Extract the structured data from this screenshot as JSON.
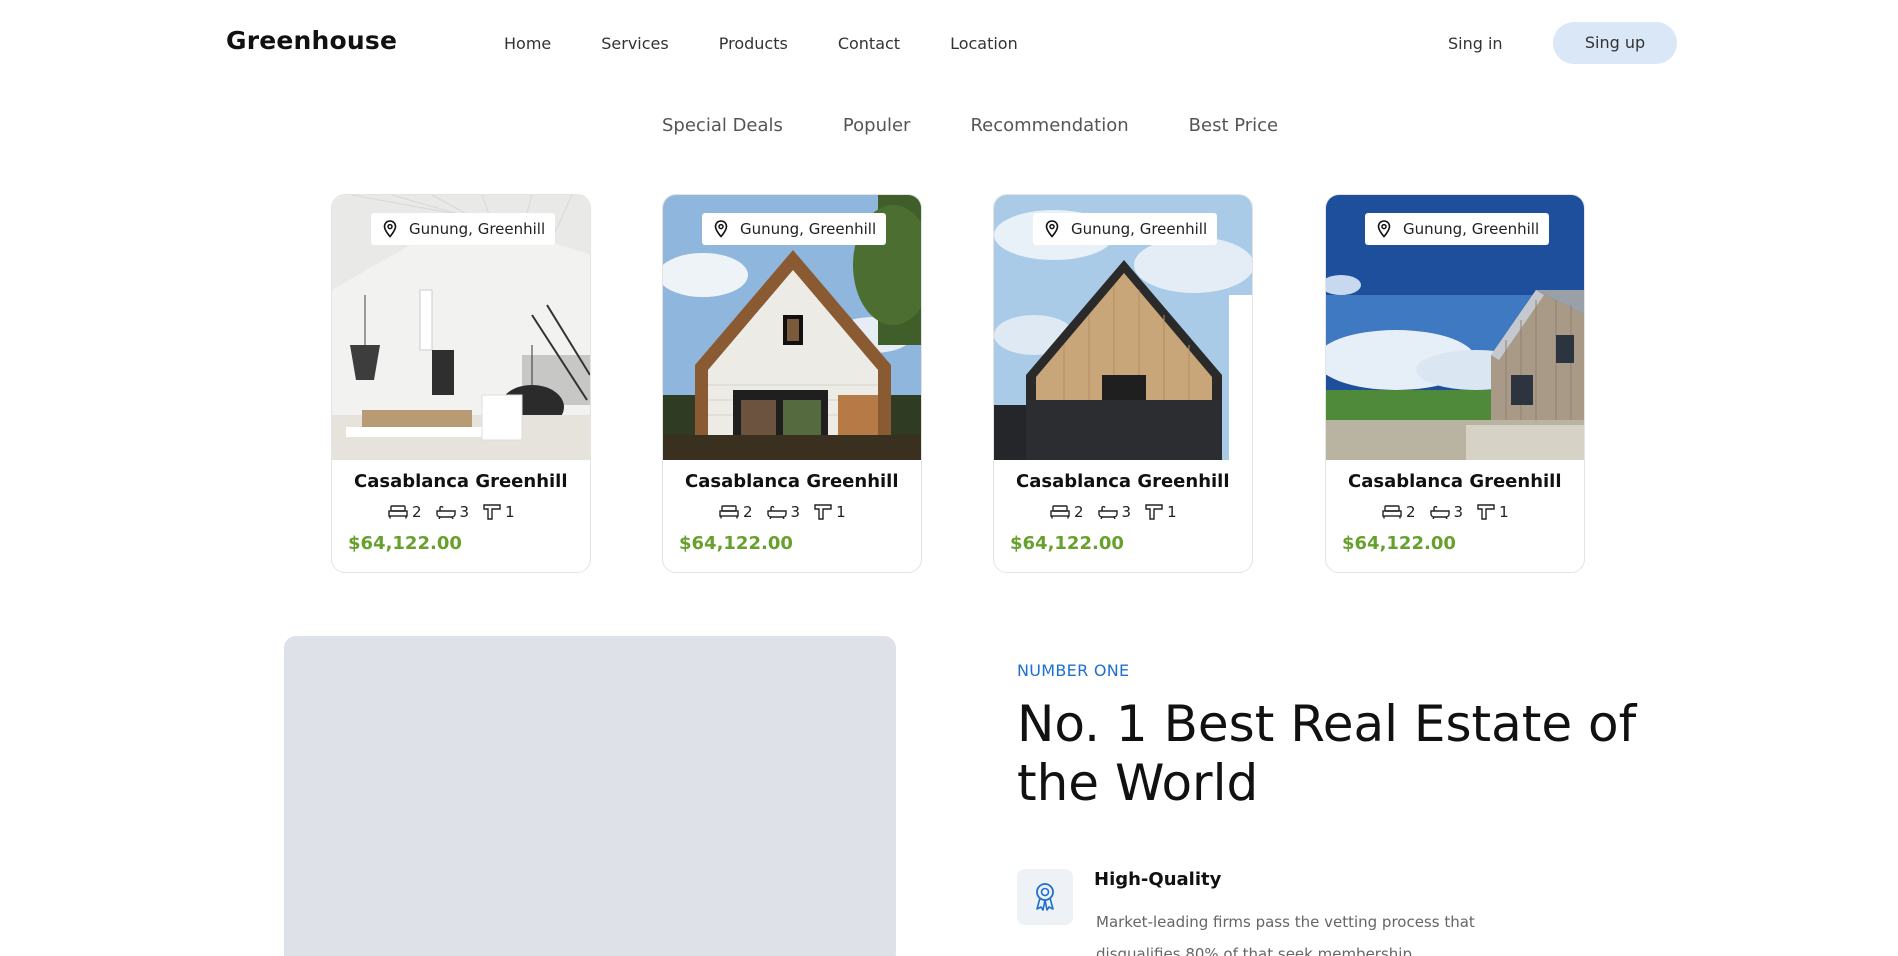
{
  "brand": "Greenhouse",
  "nav": {
    "items": [
      "Home",
      "Services",
      "Products",
      "Contact",
      "Location"
    ],
    "signin": "Sing in",
    "signup": "Sing up"
  },
  "filters": [
    "Special Deals",
    "Populer",
    "Recommendation",
    "Best Price"
  ],
  "listings": [
    {
      "location": "Gunung, Greenhill",
      "title": "Casablanca Greenhill",
      "beds": "2",
      "baths": "3",
      "rooms": "1",
      "price": "$64,122.00"
    },
    {
      "location": "Gunung, Greenhill",
      "title": "Casablanca Greenhill",
      "beds": "2",
      "baths": "3",
      "rooms": "1",
      "price": "$64,122.00"
    },
    {
      "location": "Gunung, Greenhill",
      "title": "Casablanca Greenhill",
      "beds": "2",
      "baths": "3",
      "rooms": "1",
      "price": "$64,122.00"
    },
    {
      "location": "Gunung, Greenhill",
      "title": "Casablanca Greenhill",
      "beds": "2",
      "baths": "3",
      "rooms": "1",
      "price": "$64,122.00"
    }
  ],
  "about": {
    "eyebrow": "NUMBER ONE",
    "headline": "No. 1 Best Real Estate of the World",
    "feature": {
      "title": "High-Quality",
      "text": "Market-leading firms pass the vetting process that disqualifies 80% of that seek membership.",
      "icon": "award-ribbon-icon"
    }
  },
  "colors": {
    "accent": "#1f6fd0",
    "price": "#67a02c",
    "signup_bg": "#d9e7f6",
    "placeholder": "#dee1e8"
  }
}
